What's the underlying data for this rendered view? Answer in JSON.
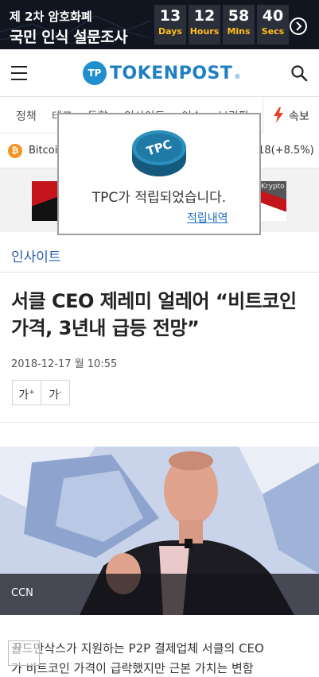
{
  "banner": {
    "line1": "제 2차 암호화폐",
    "line2": "국민 인식 설문조사",
    "countdown": [
      {
        "value": "13",
        "unit": "Days"
      },
      {
        "value": "12",
        "unit": "Hours"
      },
      {
        "value": "58",
        "unit": "Mins"
      },
      {
        "value": "40",
        "unit": "Secs"
      }
    ]
  },
  "header": {
    "logo_mark": "TP",
    "logo_text": "TOKENPOST",
    "logo_reg": "®"
  },
  "nav": {
    "items": [
      "정책",
      "테크",
      "동향",
      "인사이트",
      "이슈",
      "브리핑"
    ],
    "breaking": "속보"
  },
  "ticker": {
    "coin_symbol": "₿",
    "coin_name": "Bitcoi",
    "coin_change": ".18(+8.5%)"
  },
  "ad": {
    "right_text": "Krypto"
  },
  "popup": {
    "coin_label": "TPC",
    "message": "TPC가 적립되었습니다.",
    "link": "적립내역"
  },
  "article": {
    "category": "인사이트",
    "title_line1": "서클 CEO 제레미 얼레어 “비트코인",
    "title_line2": "가격, 3년내 급등 전망”",
    "date": "2018-12-17 월 10:55",
    "font_up": "가",
    "font_up_sign": "+",
    "font_down": "가",
    "font_down_sign": "-",
    "photo_caption": "CCN",
    "body_line1": "골드만삭스가 지원하는 P2P 결제업체 서클의 CEO",
    "body_line2": "가 비트코인 가격이 급락했지만 근본 가치는 변함"
  },
  "colors": {
    "accent": "#1f7fc2",
    "category": "#2a5fb0",
    "countdown_label": "#ffbe1a",
    "banner_bg": "#10151f"
  }
}
